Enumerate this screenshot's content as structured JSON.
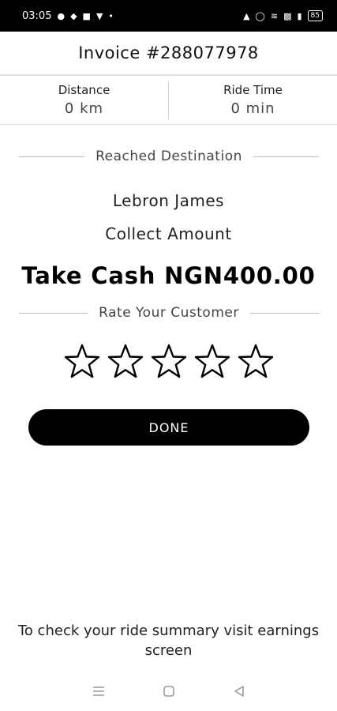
{
  "status_bar": {
    "time": "03:05",
    "battery": "85"
  },
  "invoice": {
    "title": "Invoice #288077978"
  },
  "stats": {
    "distance_label": "Distance",
    "distance_value": "0 km",
    "ride_time_label": "Ride Time",
    "ride_time_value": "0 min"
  },
  "trip": {
    "status": "Reached Destination",
    "customer_name": "Lebron James",
    "collect_label": "Collect Amount",
    "cash_text": "Take Cash NGN400.00"
  },
  "rating": {
    "label": "Rate Your Customer",
    "max_stars": 5,
    "value": 0
  },
  "actions": {
    "done_label": "DONE"
  },
  "footer": {
    "note": "To check your ride summary visit earnings screen"
  },
  "icons": {
    "star": "star-outline-icon",
    "nav_menu": "menu-icon",
    "nav_home": "home-icon",
    "nav_back": "back-icon"
  }
}
